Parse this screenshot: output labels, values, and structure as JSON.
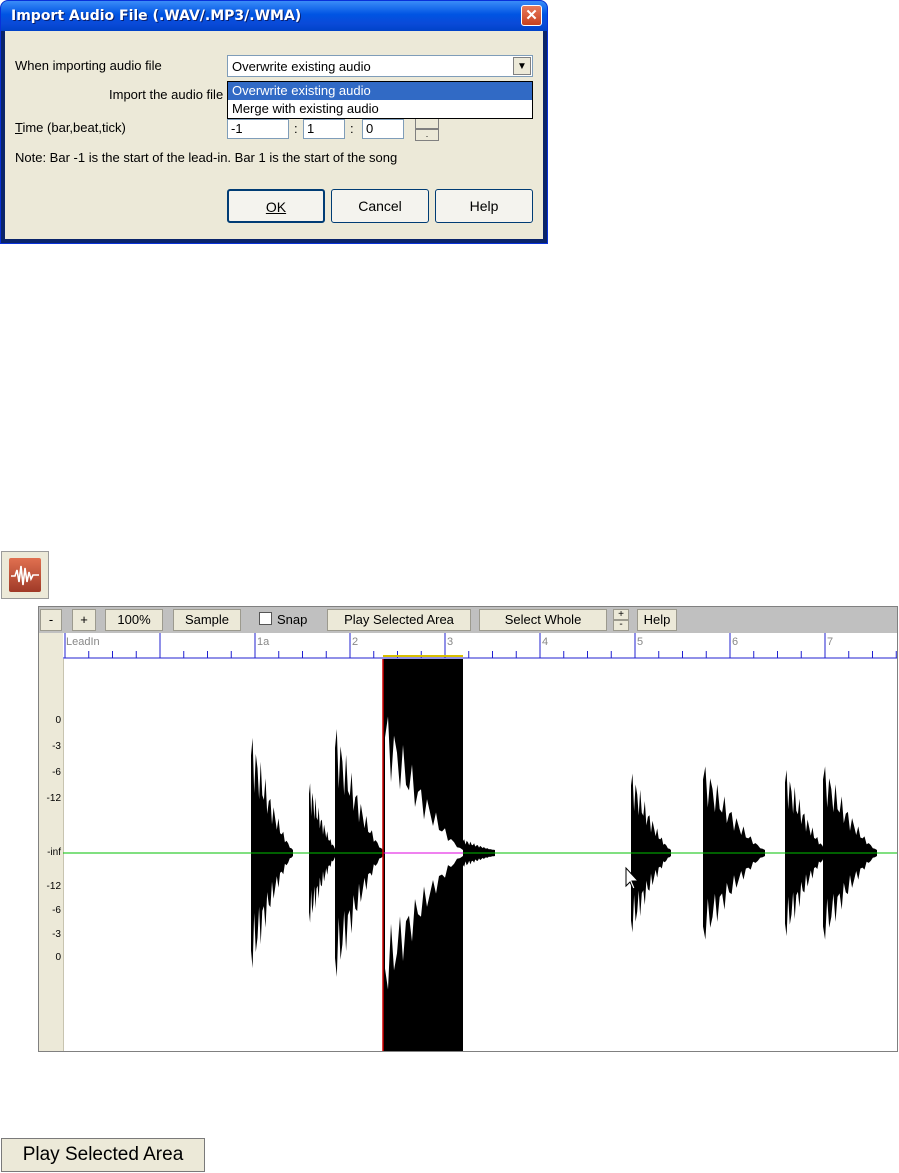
{
  "dialog": {
    "title": "Import Audio File (.WAV/.MP3/.WMA)",
    "close_glyph": "✕",
    "import_label": "When importing audio file",
    "import_mode": {
      "selected": "Overwrite existing audio",
      "options": [
        "Overwrite existing audio",
        "Merge with existing audio"
      ]
    },
    "import_at_label": "Import the audio file",
    "time_label": "Time (bar,beat,tick)",
    "time_bar": "-1",
    "time_beat": "1",
    "time_tick": "0",
    "separator": ":",
    "note": "Note: Bar -1 is the start of the lead-in. Bar 1 is the start of the song",
    "ok": "OK",
    "cancel": "Cancel",
    "help": "Help"
  },
  "editor": {
    "toolbar": {
      "zoom_out": "-",
      "zoom_in": "+",
      "zoom_100": "100%",
      "sample": "Sample",
      "snap": "Snap",
      "play_selected": "Play Selected Area",
      "select_whole": "Select Whole",
      "spin_up": "+",
      "spin_down": "-",
      "help": "Help"
    },
    "ruler_labels": [
      "LeadIn",
      "1a",
      "2",
      "3",
      "4",
      "5",
      "6",
      "7"
    ],
    "db_scale": [
      "0",
      "-3",
      "-6",
      "-12",
      "-inf",
      "-12",
      "-6",
      "-3",
      "0"
    ],
    "colors": {
      "waveform": "#000000",
      "selection": "#000000",
      "center_line": "#00c000",
      "cursor": "#d00000",
      "ruler": "#2020d0"
    }
  },
  "play_button": "Play Selected Area"
}
